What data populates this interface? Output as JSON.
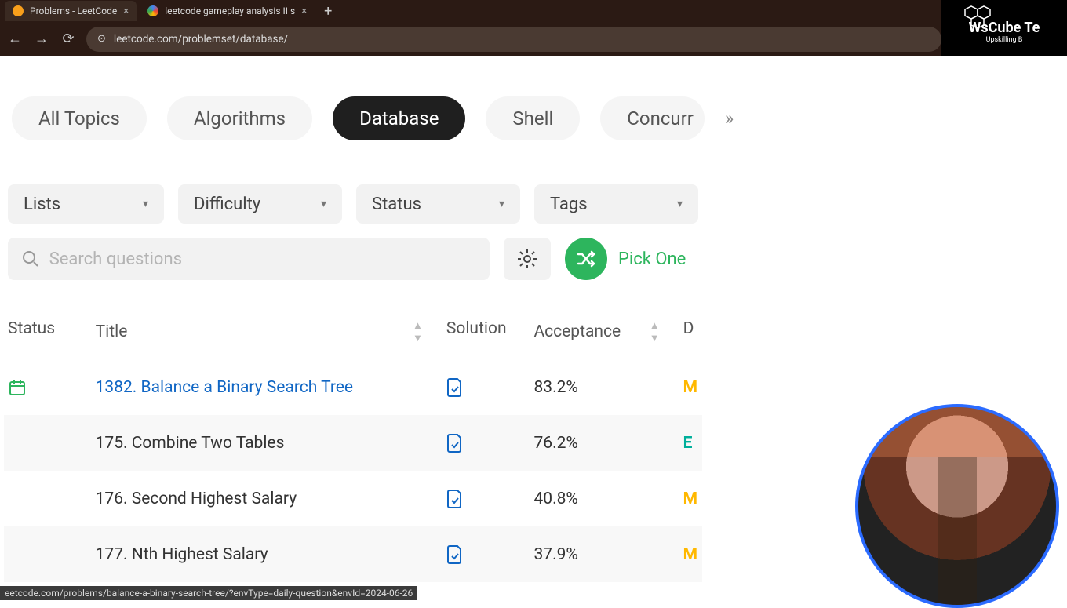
{
  "browser": {
    "tabs": [
      {
        "title": "Problems - LeetCode",
        "active": true
      },
      {
        "title": "leetcode gameplay analysis II s",
        "active": false
      }
    ],
    "url": "leetcode.com/problemset/database/",
    "status_url": "eetcode.com/problems/balance-a-binary-search-tree/?envType=daily-question&envId=2024-06-26"
  },
  "watermark": {
    "brand": "WsCube Te",
    "tagline": "Upskilling B"
  },
  "topics": {
    "items": [
      "All Topics",
      "Algorithms",
      "Database",
      "Shell",
      "Concurr"
    ],
    "active_index": 2
  },
  "filters": {
    "lists": "Lists",
    "difficulty": "Difficulty",
    "status": "Status",
    "tags": "Tags"
  },
  "search": {
    "placeholder": "Search questions"
  },
  "pick_one": "Pick One",
  "columns": {
    "status": "Status",
    "title": "Title",
    "solution": "Solution",
    "acceptance": "Acceptance",
    "difficulty": "D"
  },
  "problems": [
    {
      "status": "daily",
      "title": "1382. Balance a Binary Search Tree",
      "acceptance": "83.2%",
      "diff": "M",
      "highlight": true
    },
    {
      "status": "",
      "title": "175. Combine Two Tables",
      "acceptance": "76.2%",
      "diff": "E"
    },
    {
      "status": "",
      "title": "176. Second Highest Salary",
      "acceptance": "40.8%",
      "diff": "M"
    },
    {
      "status": "",
      "title": "177. Nth Highest Salary",
      "acceptance": "37.9%",
      "diff": "M"
    }
  ]
}
